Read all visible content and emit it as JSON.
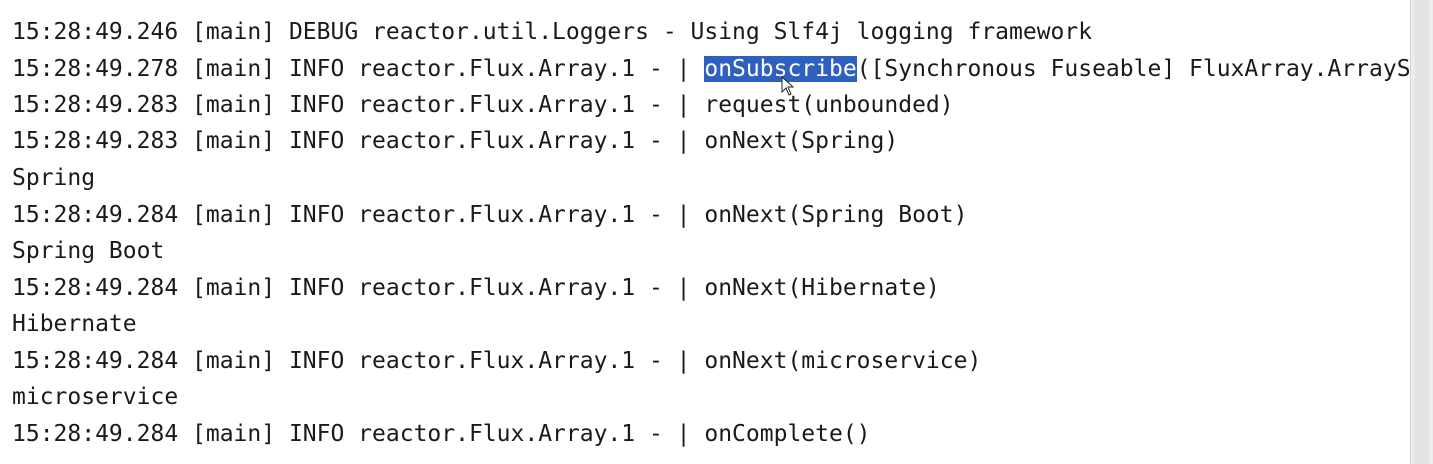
{
  "console": {
    "lines": [
      "15:28:49.246 [main] DEBUG reactor.util.Loggers - Using Slf4j logging framework",
      {
        "before": "15:28:49.278 [main] INFO reactor.Flux.Array.1 - | ",
        "selected": "onSubscribe",
        "after": "([Synchronous Fuseable] FluxArray.ArrayS"
      },
      "15:28:49.283 [main] INFO reactor.Flux.Array.1 - | request(unbounded)",
      "15:28:49.283 [main] INFO reactor.Flux.Array.1 - | onNext(Spring)",
      "Spring",
      "15:28:49.284 [main] INFO reactor.Flux.Array.1 - | onNext(Spring Boot)",
      "Spring Boot",
      "15:28:49.284 [main] INFO reactor.Flux.Array.1 - | onNext(Hibernate)",
      "Hibernate",
      "15:28:49.284 [main] INFO reactor.Flux.Array.1 - | onNext(microservice)",
      "microservice",
      "15:28:49.284 [main] INFO reactor.Flux.Array.1 - | onComplete()"
    ]
  },
  "colors": {
    "selection": "#2f5fbf",
    "text": "#1a1a1a"
  }
}
